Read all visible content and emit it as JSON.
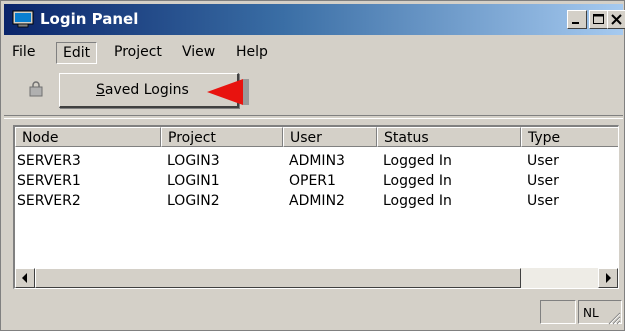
{
  "window": {
    "title": "Login Panel"
  },
  "menu": {
    "items": [
      "File",
      "Edit",
      "Project",
      "View",
      "Help"
    ],
    "active": "Edit"
  },
  "dropdown": {
    "item_label": "Saved Logins",
    "mnemonic": "S"
  },
  "list": {
    "columns": [
      "Node",
      "Project",
      "User",
      "Status",
      "Type"
    ],
    "rows": [
      [
        "SERVER3",
        "LOGIN3",
        "ADMIN3",
        "Logged In",
        "User"
      ],
      [
        "SERVER1",
        "LOGIN1",
        "OPER1",
        "Logged In",
        "User"
      ],
      [
        "SERVER2",
        "LOGIN2",
        "ADMIN2",
        "Logged In",
        "User"
      ]
    ]
  },
  "statusbar": {
    "indicator": "NL"
  },
  "colors": {
    "title_gradient_start": "#0a246a",
    "title_gradient_end": "#a6caf0",
    "arrow": "#e8130f",
    "face": "#d4d0c8"
  },
  "icons": {
    "app": "monitor-icon",
    "toolbar": "login-icon",
    "pointer": "red-arrow-icon"
  }
}
